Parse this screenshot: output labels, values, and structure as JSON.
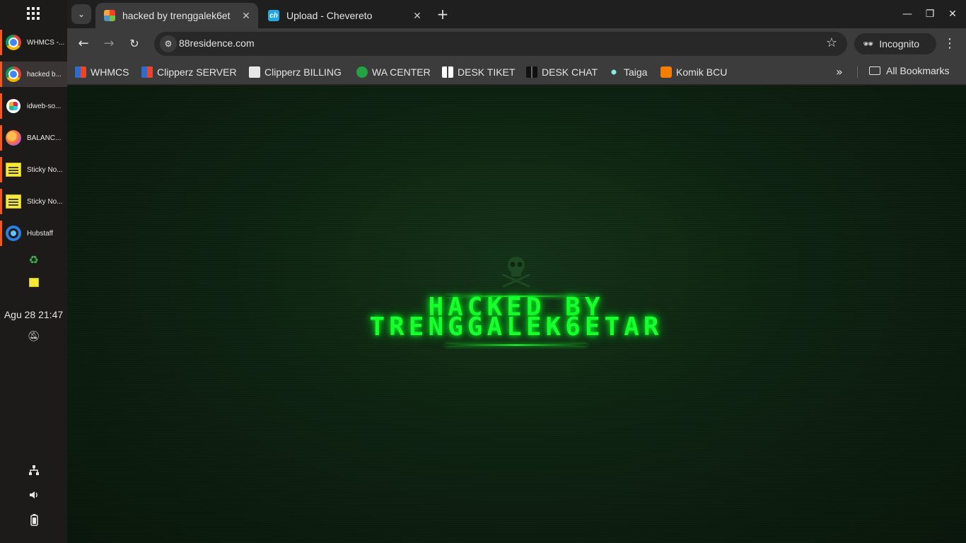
{
  "dock": {
    "items": [
      {
        "label": "WHMCS -...",
        "icon": "chrome-icon"
      },
      {
        "label": "hacked b...",
        "icon": "chrome-icon"
      },
      {
        "label": "idweb-so...",
        "icon": "slack-icon"
      },
      {
        "label": "BALANC...",
        "icon": "firefox-icon"
      },
      {
        "label": "Sticky No...",
        "icon": "sticky-notes-icon"
      },
      {
        "label": "Sticky No...",
        "icon": "sticky-notes-icon"
      },
      {
        "label": "Hubstaff",
        "icon": "hubstaff-icon"
      }
    ],
    "clock": "Agu 28  21:47"
  },
  "browser": {
    "tabs": [
      {
        "title": "hacked by trenggalek6et",
        "active": true
      },
      {
        "title": "Upload - Chevereto",
        "active": false
      }
    ],
    "address": "88residence.com",
    "incognito_label": "Incognito",
    "bookmarks": [
      "WHMCS",
      "Clipperz SERVER",
      "Clipperz BILLING",
      "WA CENTER",
      "DESK TIKET",
      "DESK CHAT",
      "Taiga",
      "Komik BCU"
    ],
    "all_bookmarks": "All Bookmarks"
  },
  "page": {
    "line1": "HACKED BY",
    "line2": "TRENGGALEK6ETAR"
  },
  "colors": {
    "accent_green": "#19ff2e",
    "dock_indicator": "#f05a22",
    "toolbar": "#3c3c3c"
  }
}
